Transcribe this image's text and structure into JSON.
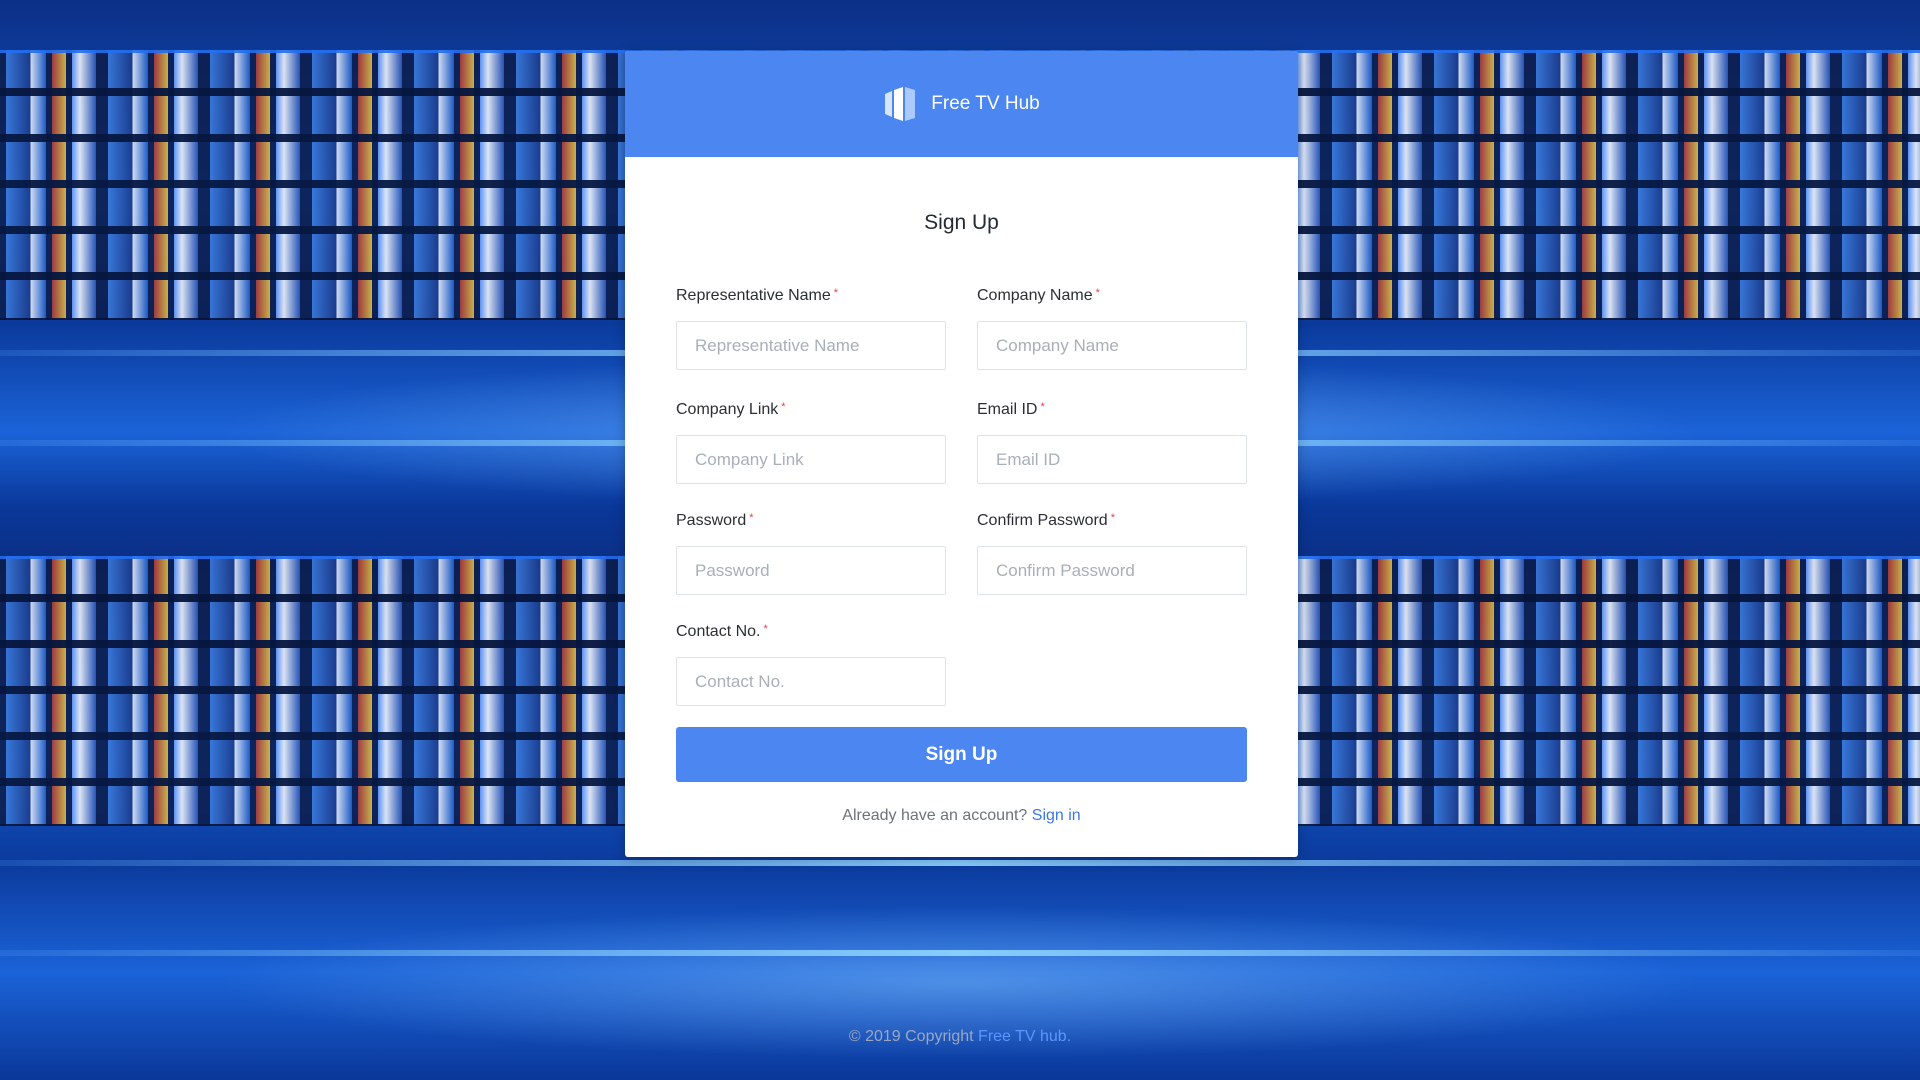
{
  "brand": {
    "name": "Free TV Hub",
    "logo_icon": "tv-panels-icon",
    "header_color": "#4b86f1"
  },
  "form": {
    "title": "Sign Up",
    "required_marker": "*",
    "fields": {
      "representative_name": {
        "label": "Representative Name",
        "placeholder": "Representative Name",
        "value": ""
      },
      "company_name": {
        "label": "Company Name",
        "placeholder": "Company Name",
        "value": ""
      },
      "company_link": {
        "label": "Company Link",
        "placeholder": "Company Link",
        "value": ""
      },
      "email_id": {
        "label": "Email ID",
        "placeholder": "Email ID",
        "value": ""
      },
      "password": {
        "label": "Password",
        "placeholder": "Password",
        "value": ""
      },
      "confirm_password": {
        "label": "Confirm Password",
        "placeholder": "Confirm Password",
        "value": ""
      },
      "contact_no": {
        "label": "Contact No.",
        "placeholder": "Contact No.",
        "value": ""
      }
    },
    "submit_label": "Sign Up",
    "signin_prompt": "Already have an account?",
    "signin_link": "Sign in"
  },
  "footer": {
    "copyright": "© 2019 Copyright",
    "link": "Free TV hub."
  },
  "colors": {
    "accent": "#4b86f1",
    "link": "#3c77e6",
    "required": "#e04444",
    "background": "#0a3ea8"
  }
}
